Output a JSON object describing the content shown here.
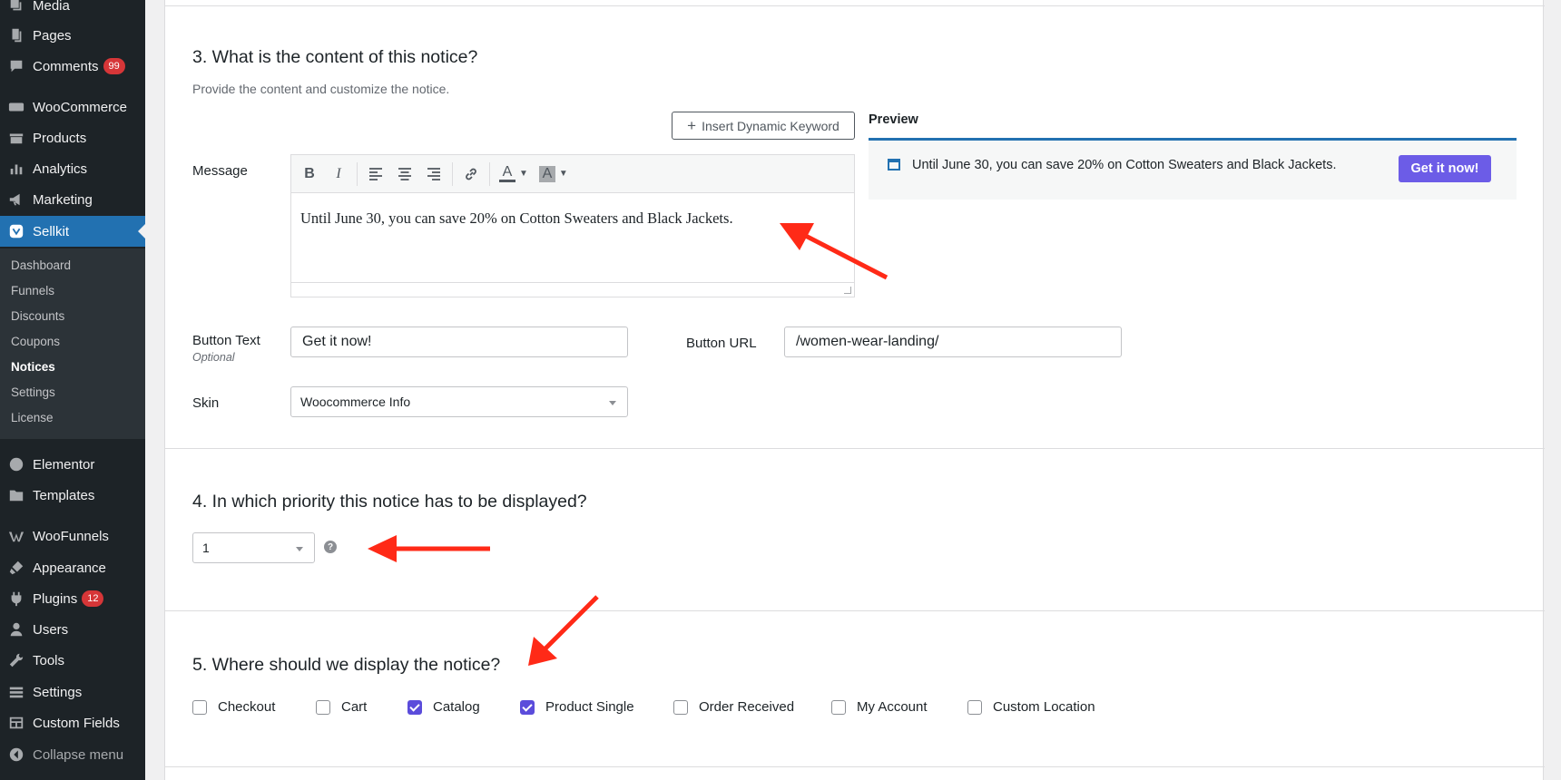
{
  "sidebar": {
    "items": [
      {
        "label": "Media",
        "icon": "media-icon"
      },
      {
        "label": "Pages",
        "icon": "pages-icon"
      },
      {
        "label": "Comments",
        "icon": "comments-icon",
        "badge": "99"
      },
      {
        "label": "WooCommerce",
        "icon": "woocommerce-icon"
      },
      {
        "label": "Products",
        "icon": "products-icon"
      },
      {
        "label": "Analytics",
        "icon": "analytics-icon"
      },
      {
        "label": "Marketing",
        "icon": "marketing-icon"
      },
      {
        "label": "Sellkit",
        "icon": "sellkit-icon"
      },
      {
        "label": "Elementor",
        "icon": "elementor-icon"
      },
      {
        "label": "Templates",
        "icon": "templates-icon"
      },
      {
        "label": "WooFunnels",
        "icon": "woofunnels-icon"
      },
      {
        "label": "Appearance",
        "icon": "appearance-icon"
      },
      {
        "label": "Plugins",
        "icon": "plugins-icon",
        "badge": "12"
      },
      {
        "label": "Users",
        "icon": "users-icon"
      },
      {
        "label": "Tools",
        "icon": "tools-icon"
      },
      {
        "label": "Settings",
        "icon": "settings-icon"
      },
      {
        "label": "Custom Fields",
        "icon": "custom-fields-icon"
      },
      {
        "label": "Collapse menu",
        "icon": "collapse-icon"
      }
    ],
    "submenu": [
      "Dashboard",
      "Funnels",
      "Discounts",
      "Coupons",
      "Notices",
      "Settings",
      "License"
    ],
    "current_submenu": "Notices",
    "active_color": "#2271b1"
  },
  "section3": {
    "title": "3. What is the content of this notice?",
    "description": "Provide the content and customize the notice.",
    "insert_keyword_label": "Insert Dynamic Keyword",
    "message_label": "Message",
    "editor_text": "Until June 30, you can save 20% on Cotton Sweaters and Black Jackets.",
    "toolbar_icons": [
      "bold-icon",
      "italic-icon",
      "align-left-icon",
      "align-center-icon",
      "align-right-icon",
      "link-icon",
      "text-color-icon",
      "background-color-icon"
    ],
    "preview": {
      "title": "Preview",
      "message": "Until June 30, you can save 20% on Cotton Sweaters and Black Jackets.",
      "button": "Get it now!",
      "button_color": "#6c5ce7",
      "border_color": "#2271b1"
    },
    "button_text_label": "Button Text",
    "button_text_sublabel": "Optional",
    "button_text_value": "Get it now!",
    "button_url_label": "Button URL",
    "button_url_value": "/women-wear-landing/",
    "skin_label": "Skin",
    "skin_value": "Woocommerce Info"
  },
  "section4": {
    "title": "4. In which priority this notice has to be displayed?",
    "priority_value": "1"
  },
  "section5": {
    "title": "5. Where should we display the notice?",
    "options": [
      {
        "label": "Checkout",
        "checked": false
      },
      {
        "label": "Cart",
        "checked": false
      },
      {
        "label": "Catalog",
        "checked": true
      },
      {
        "label": "Product Single",
        "checked": true
      },
      {
        "label": "Order Received",
        "checked": false
      },
      {
        "label": "My Account",
        "checked": false
      },
      {
        "label": "Custom Location",
        "checked": false
      }
    ],
    "check_color": "#5b4cdb"
  },
  "annotation_color": "#ff2a17"
}
